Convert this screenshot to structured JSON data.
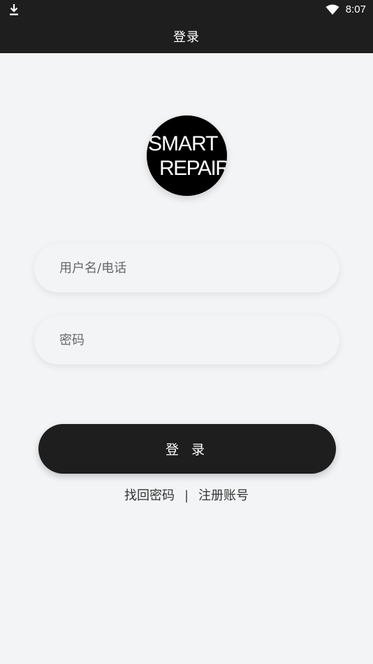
{
  "status_bar": {
    "time": "8:07",
    "icons": [
      "download-icon",
      "wifi-icon"
    ]
  },
  "header": {
    "title": "登录"
  },
  "logo": {
    "line1": "SMART",
    "line2": "REPAIR"
  },
  "form": {
    "username_placeholder": "用户名/电话",
    "password_placeholder": "密码",
    "login_label": "登 录"
  },
  "links": {
    "forgot_password": "找回密码",
    "separator": "|",
    "register": "注册账号"
  },
  "colors": {
    "bar": "#1e1e1e",
    "background": "#f3f4f6",
    "button": "#1e1e1e"
  }
}
